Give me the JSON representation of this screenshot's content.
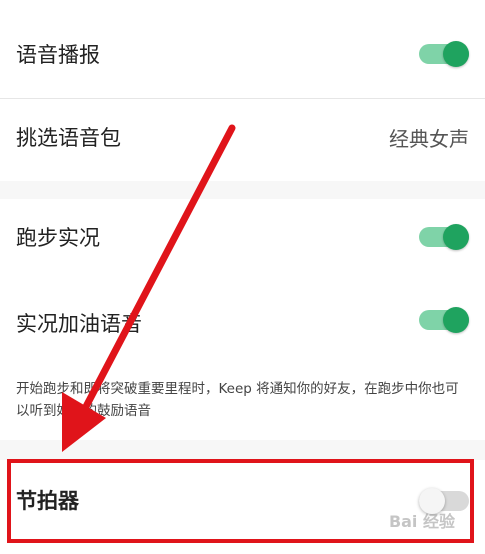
{
  "settings": {
    "voice_broadcast": {
      "label": "语音播报",
      "enabled": true
    },
    "voice_pack": {
      "label": "挑选语音包",
      "value": "经典女声"
    },
    "running_live": {
      "label": "跑步实况",
      "enabled": true
    },
    "cheer_voice": {
      "label": "实况加油语音",
      "enabled": true,
      "hint": "开始跑步和即将突破重要里程时，Keep 将通知你的好友，在跑步中你也可以听到好友的鼓励语音"
    },
    "metronome": {
      "label": "节拍器",
      "enabled": false
    }
  },
  "colors": {
    "toggle_on_track": "#7fd3a8",
    "toggle_on_knob": "#1fa35f",
    "annotation_red": "#e0141a"
  },
  "watermark": "Bai 经验"
}
